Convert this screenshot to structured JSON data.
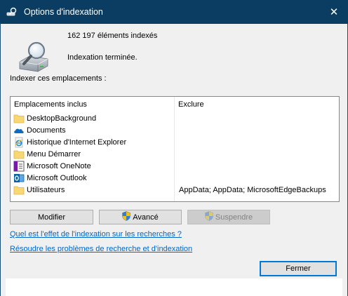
{
  "window": {
    "title": "Options d'indexation",
    "close_glyph": "✕"
  },
  "status": {
    "count": "162 197 éléments indexés",
    "state": "Indexation terminée."
  },
  "section_label": "Indexer ces emplacements :",
  "table": {
    "col_included": "Emplacements inclus",
    "col_exclude": "Exclure",
    "rows": [
      {
        "label": "DesktopBackground",
        "icon": "folder-icon",
        "exclude": ""
      },
      {
        "label": "Documents",
        "icon": "onedrive-cloud-icon",
        "exclude": ""
      },
      {
        "label": "Historique d'Internet Explorer",
        "icon": "internet-explorer-icon",
        "exclude": ""
      },
      {
        "label": "Menu Démarrer",
        "icon": "folder-icon",
        "exclude": ""
      },
      {
        "label": "Microsoft OneNote",
        "icon": "onenote-icon",
        "exclude": ""
      },
      {
        "label": "Microsoft Outlook",
        "icon": "outlook-icon",
        "exclude": ""
      },
      {
        "label": "Utilisateurs",
        "icon": "folder-icon",
        "exclude": "AppData; AppData; MicrosoftEdgeBackups"
      }
    ]
  },
  "buttons": {
    "modify": "Modifier",
    "advanced": "Avancé",
    "suspend": "Suspendre",
    "close": "Fermer"
  },
  "links": {
    "effect": "Quel est l'effet de l'indexation sur les recherches ?",
    "troubleshoot": "Résoudre les problèmes de recherche et d'indexation"
  },
  "colors": {
    "titlebar": "#0b3d63",
    "link": "#0066cc",
    "accent": "#0078d7",
    "folder": "#f8d775"
  }
}
